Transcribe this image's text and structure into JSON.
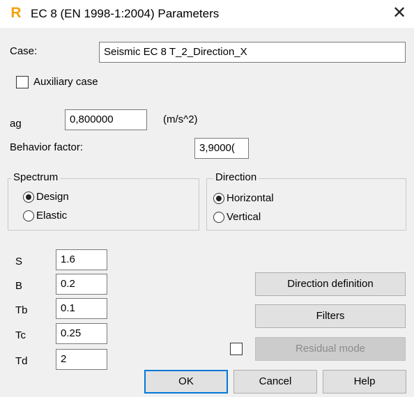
{
  "window": {
    "title": "EC 8 (EN 1998-1:2004) Parameters",
    "app_icon": "R",
    "close_glyph": "✕"
  },
  "case": {
    "label": "Case:",
    "value": "Seismic EC 8 T_2_Direction_X"
  },
  "auxiliary": {
    "label": "Auxiliary case",
    "checked": false
  },
  "ag": {
    "label": "ag",
    "value": "0,800000",
    "unit": "(m/s^2)"
  },
  "behavior": {
    "label": "Behavior factor:",
    "value": "3,9000("
  },
  "spectrum": {
    "title": "Spectrum",
    "options": [
      "Design",
      "Elastic"
    ],
    "selected": "Design"
  },
  "direction": {
    "title": "Direction",
    "options": [
      "Horizontal",
      "Vertical"
    ],
    "selected": "Horizontal"
  },
  "params": [
    {
      "label": "S",
      "value": "1.6"
    },
    {
      "label": "B",
      "value": "0.2"
    },
    {
      "label": "Tb",
      "value": "0.1"
    },
    {
      "label": "Tc",
      "value": "0.25"
    },
    {
      "label": "Td",
      "value": "2"
    }
  ],
  "buttons": {
    "direction_definition": "Direction definition",
    "filters": "Filters",
    "residual_mode": "Residual mode",
    "ok": "OK",
    "cancel": "Cancel",
    "help": "Help"
  },
  "residual_checkbox_checked": false,
  "colors": {
    "dialog_bg": "#f0f0f0",
    "default_button_border": "#0078d7",
    "app_icon": "#f2a20c"
  }
}
